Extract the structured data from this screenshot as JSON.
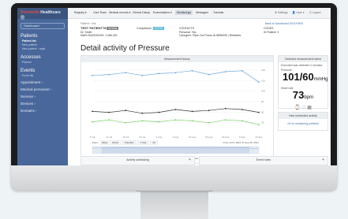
{
  "app": {
    "logo": "Docmedia",
    "logo_suffix": "Healthcare",
    "logo_mark": "Ⓡ"
  },
  "sidebar": {
    "dashboard": "Dashboard",
    "patients_label": "Patients",
    "patients_items": [
      "Patient list",
      "New patient",
      "New patient - rapid"
    ],
    "accesses_label": "Accesses",
    "accesses_items": [
      "Planner"
    ],
    "events_label": "Events",
    "events_items": [
      "Event list"
    ],
    "links": [
      "Appointment ›",
      "Medical personnel ›",
      "Surveys ›",
      "Devices ›",
      "Domains ›"
    ]
  },
  "topnav": {
    "items": [
      "Registry ▾",
      "Care Team",
      "Medical records ▾",
      "Clinical Diarys",
      "Examinations ▾",
      "Monitorings",
      "Messages",
      "Tutorials"
    ],
    "active_index": 5,
    "right": [
      "⚙ Settings",
      "👤 User ▾",
      "⏻ Logout"
    ]
  },
  "breadcrumb": "Patient › Info",
  "view_link": "Back to Dashboard 2021/09/02",
  "patient": {
    "name": "TEST PATIENT78",
    "badge": "ACTIVE",
    "line2": "Dr. Smith",
    "line3": "MAIN DIAGNOSIS: 1.456.431",
    "compliance_label": "Compliance:",
    "compliance_value": "GOOD"
  },
  "contacts": {
    "title": "CONTACTS",
    "line1": "Personal: Yes",
    "line2": "Caregiver: Piper Del Pozzo At 8896330 | Relatives"
  },
  "codes": {
    "title": "CODES",
    "line1": "ID Patient: 3"
  },
  "page_title": "Detail activity of Pressure",
  "chart_panel": {
    "title": "Measurement history"
  },
  "chart_data": {
    "type": "line",
    "title": "Measurement history",
    "x": [
      "5 Jul",
      "12 Jul",
      "19 Jul",
      "26 Jul",
      "2 Aug",
      "9 Aug",
      "16 Aug",
      "23 Aug",
      "30 Aug",
      "6 Sep",
      "13 Sep"
    ],
    "series": [
      {
        "name": "Max pressure",
        "values": [
          121,
          122,
          124,
          121,
          123,
          124,
          126,
          122,
          125,
          126,
          114
        ],
        "color": "#6fa7d8"
      },
      {
        "name": "Heart rate",
        "values": [
          83,
          82,
          84,
          81,
          82,
          85,
          83,
          84,
          86,
          85,
          82
        ],
        "color": "#333333"
      },
      {
        "name": "Min pressure",
        "values": [
          72,
          74,
          71,
          73,
          72,
          74,
          73,
          71,
          74,
          73,
          69
        ],
        "color": "#7ccf6a"
      }
    ],
    "ylim": [
      60,
      130
    ],
    "y_ticks": [
      "120",
      "110",
      "100",
      "90",
      "80",
      "70"
    ],
    "legend": [
      "Max pres.",
      "Heart rate",
      "Min pres."
    ],
    "zoom_label": "Zoom",
    "zoom_options": [
      "Week",
      "Month",
      "3 Months",
      "1 Year",
      "All"
    ],
    "range_label": "From  Jul 5, 2021  To  Sep 15, 2021"
  },
  "info_panel": {
    "title": "Detected measurement latest",
    "when": "Executed was detected 2 minutes",
    "pressure_label": "Pressure",
    "bp": "101/60",
    "bp_unit": "mmHg",
    "hr_label": "Heart rate",
    "hr": "73",
    "hr_unit": "bpm",
    "icons": "⌚ ♡ ▦"
  },
  "add_panel": {
    "title": "New scheduled activity",
    "link": "Go to monitoring portfolio"
  },
  "sched_panel": {
    "title": "Activity scheduling"
  },
  "events_panel": {
    "title": "Event notes"
  }
}
